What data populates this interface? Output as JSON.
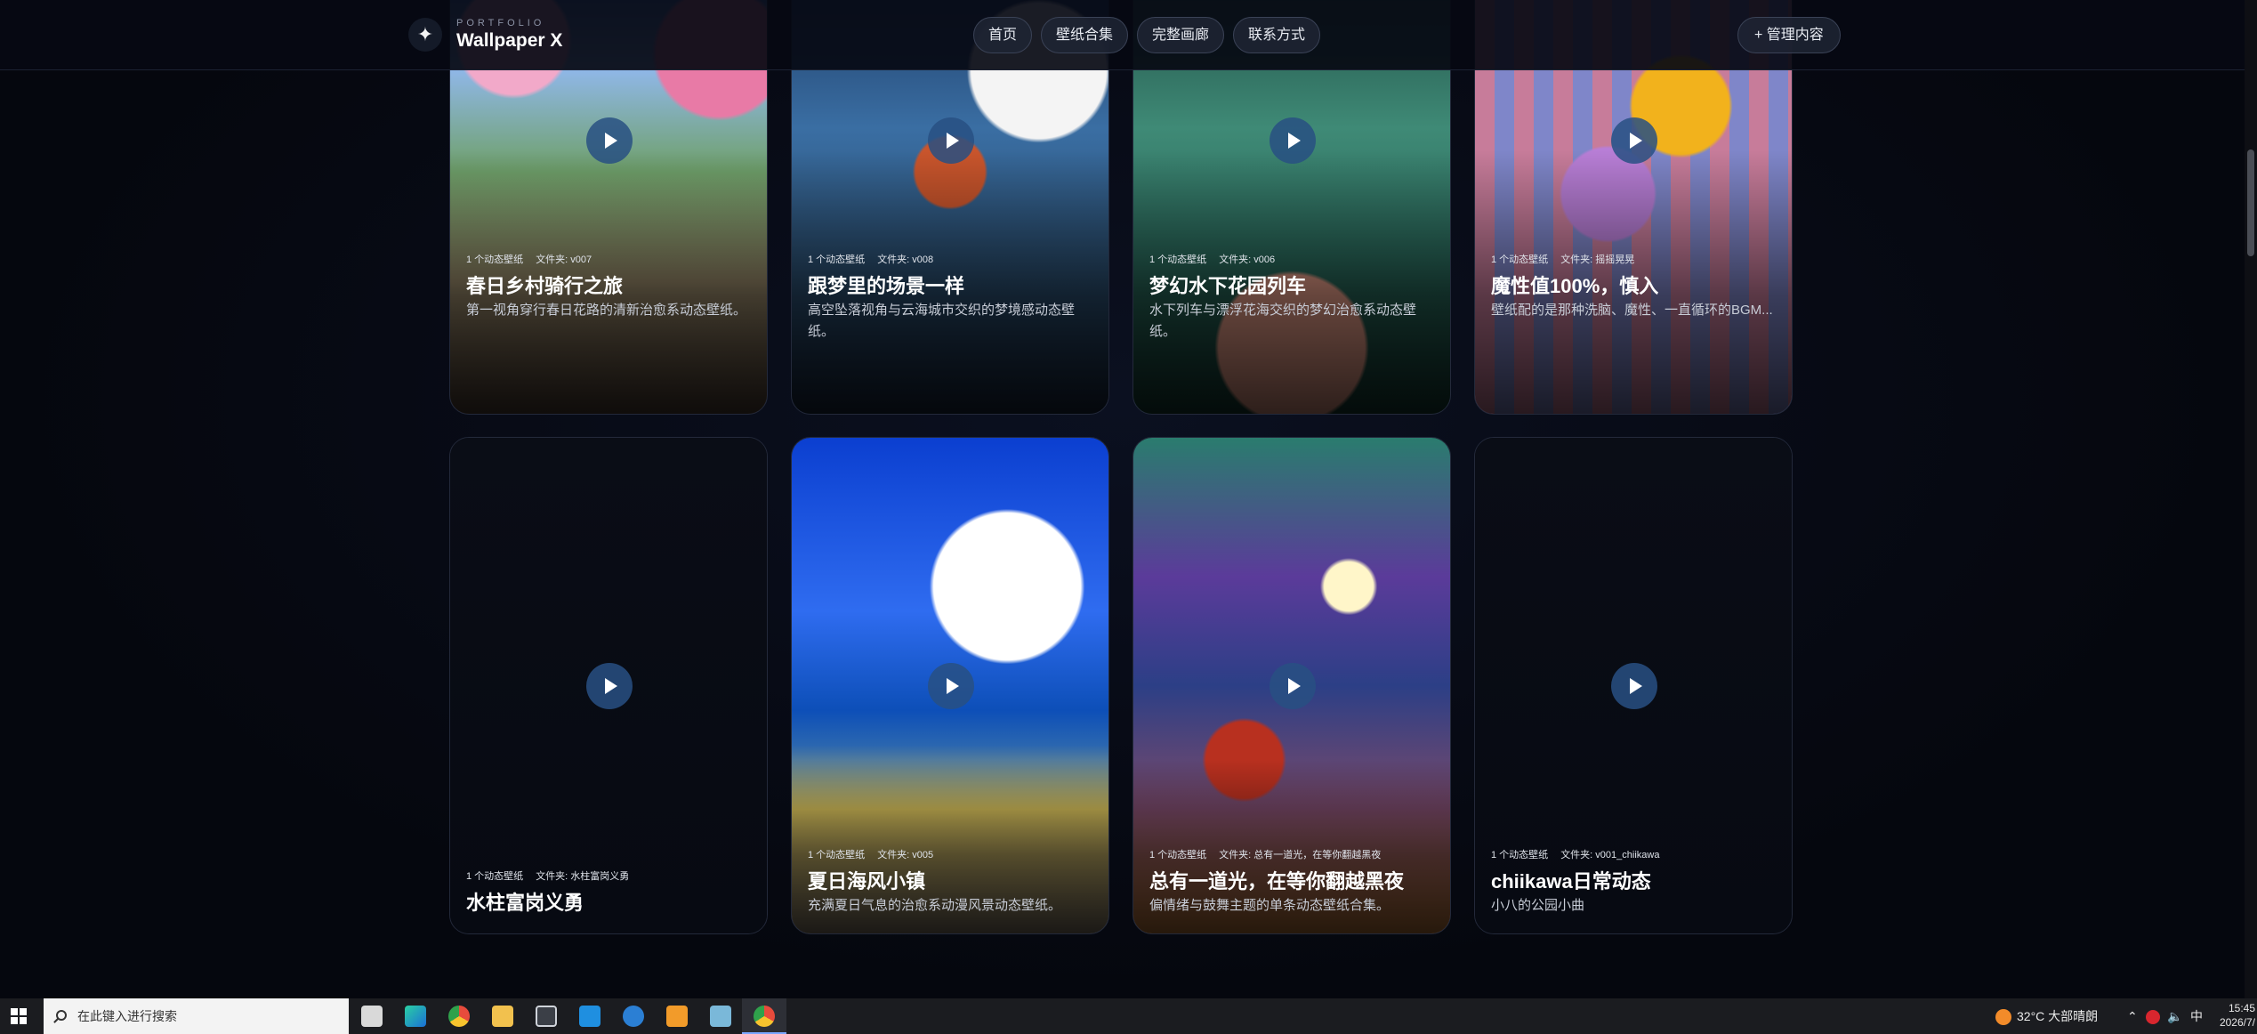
{
  "header": {
    "kicker": "PORTFOLIO",
    "title": "Wallpaper X",
    "logo_icon": "sparkle-icon",
    "nav": [
      "首页",
      "壁纸合集",
      "完整画廊",
      "联系方式"
    ],
    "admin_label": "+ 管理内容"
  },
  "cards": [
    {
      "meta_count": "1 个动态壁纸",
      "meta_folder": "文件夹: v007",
      "title": "春日乡村骑行之旅",
      "desc": "第一视角穿行春日花路的清新治愈系动态壁纸。"
    },
    {
      "meta_count": "1 个动态壁纸",
      "meta_folder": "文件夹: v008",
      "title": "跟梦里的场景一样",
      "desc": "高空坠落视角与云海城市交织的梦境感动态壁纸。"
    },
    {
      "meta_count": "1 个动态壁纸",
      "meta_folder": "文件夹: v006",
      "title": "梦幻水下花园列车",
      "desc": "水下列车与漂浮花海交织的梦幻治愈系动态壁纸。"
    },
    {
      "meta_count": "1 个动态壁纸",
      "meta_folder": "文件夹: 摇摇晃晃",
      "title": "魔性值100%，慎入",
      "desc": "壁纸配的是那种洗脑、魔性、一直循环的BGM..."
    },
    {
      "meta_count": "1 个动态壁纸",
      "meta_folder": "文件夹: 水柱富岗义勇",
      "title": "水柱富岗义勇",
      "desc": ""
    },
    {
      "meta_count": "1 个动态壁纸",
      "meta_folder": "文件夹: v005",
      "title": "夏日海风小镇",
      "desc": "充满夏日气息的治愈系动漫风景动态壁纸。"
    },
    {
      "meta_count": "1 个动态壁纸",
      "meta_folder": "文件夹: 总有一道光，在等你翻越黑夜",
      "title": "总有一道光，在等你翻越黑夜",
      "desc": "偏情绪与鼓舞主题的单条动态壁纸合集。"
    },
    {
      "meta_count": "1 个动态壁纸",
      "meta_folder": "文件夹: v001_chiikawa",
      "title": "chiikawa日常动态",
      "desc": "小八的公园小曲"
    }
  ],
  "taskbar": {
    "search_placeholder": "在此键入进行搜索",
    "weather": "32°C  大部晴朗",
    "ime": "中",
    "time": "15:45",
    "date": "2026/7/"
  }
}
